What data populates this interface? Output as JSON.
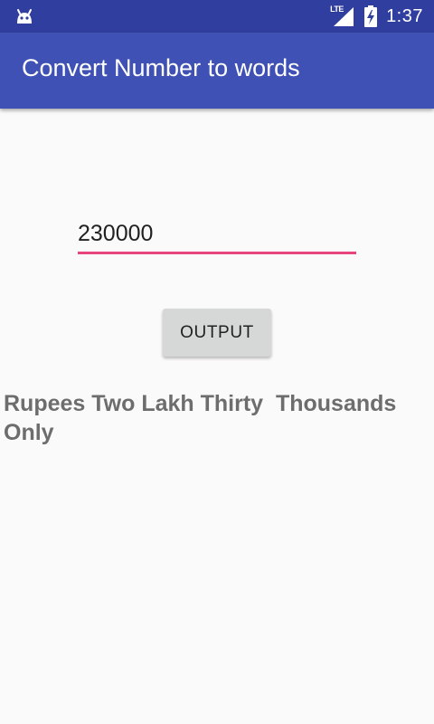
{
  "status_bar": {
    "time": "1:37",
    "network_label": "LTE",
    "icons": [
      "android-icon",
      "lte-signal-icon",
      "battery-charging-icon"
    ]
  },
  "app_bar": {
    "title": "Convert Number to words"
  },
  "input": {
    "value": "230000"
  },
  "button": {
    "label": "OUTPUT"
  },
  "result": {
    "text": "Rupees Two Lakh Thirty  Thousands Only"
  },
  "colors": {
    "status_bar": "#303f9f",
    "app_bar": "#3f51b5",
    "accent": "#e8457f",
    "background": "#fafafa",
    "button": "#d6d7d7",
    "result_text": "#6d6d6d"
  }
}
